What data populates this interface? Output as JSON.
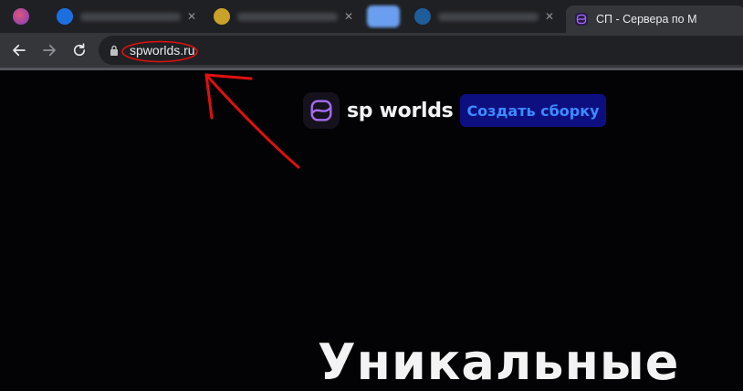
{
  "browser": {
    "active_tab": {
      "title": "СП - Сервера по M",
      "close_label": "×"
    },
    "address_bar": {
      "url": "spworlds.ru"
    }
  },
  "page": {
    "brand_name": "sp worlds",
    "cta_label": "Создать сборку",
    "hero_text": "Уникальные"
  },
  "colors": {
    "page_bg": "#030305",
    "cta_bg": "#0d0f80",
    "cta_text": "#3d8bff",
    "annotation": "#e01010",
    "logo_accent": "#a56cf0"
  }
}
